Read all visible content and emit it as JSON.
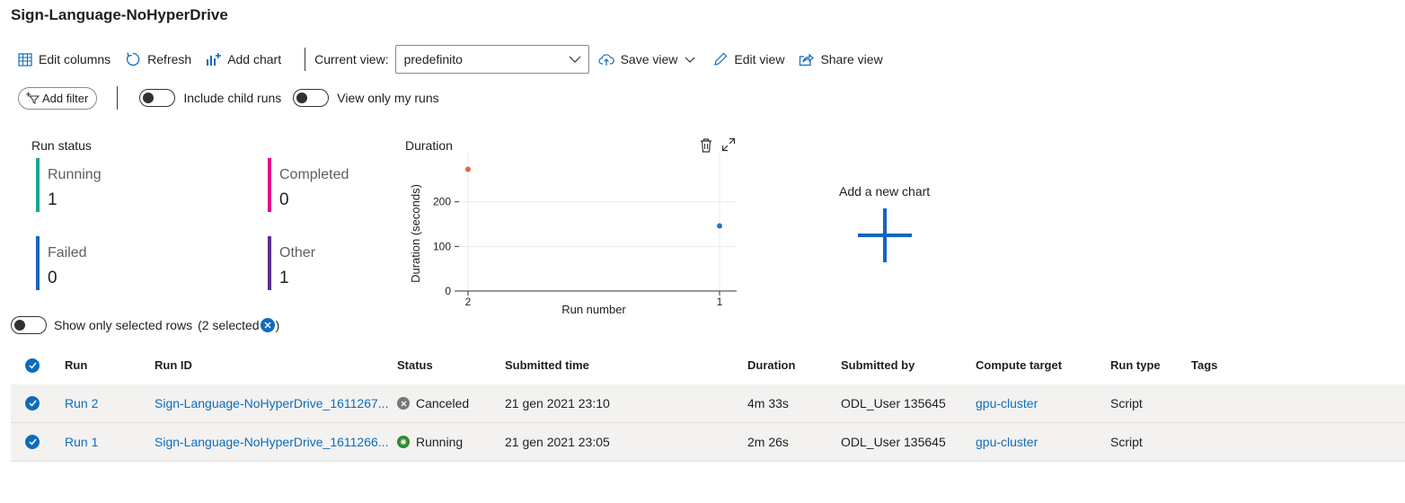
{
  "page_title": "Sign-Language-NoHyperDrive",
  "toolbar": {
    "edit_columns": "Edit columns",
    "refresh": "Refresh",
    "add_chart": "Add chart",
    "current_view_label": "Current view:",
    "current_view_value": "predefinito",
    "save_view": "Save view",
    "edit_view": "Edit view",
    "share_view": "Share view"
  },
  "filters": {
    "add_filter": "Add filter",
    "include_child_runs": "Include child runs",
    "view_only_my_runs": "View only my runs"
  },
  "run_status": {
    "title": "Run status",
    "items": [
      {
        "name": "Running",
        "value": "1",
        "color": "#1aa68a"
      },
      {
        "name": "Completed",
        "value": "0",
        "color": "#e3008c"
      },
      {
        "name": "Failed",
        "value": "0",
        "color": "#1565c0"
      },
      {
        "name": "Other",
        "value": "1",
        "color": "#5c2e91"
      }
    ]
  },
  "chart_data": {
    "type": "scatter",
    "title": "Duration",
    "xlabel": "Run number",
    "ylabel": "Duration (seconds)",
    "categories": [
      "2",
      "1"
    ],
    "values": [
      273,
      146
    ],
    "point_colors": [
      "#e8624a",
      "#1f77d0"
    ],
    "yticks": [
      0,
      100,
      200
    ],
    "ylim": [
      0,
      290
    ]
  },
  "add_new_chart": "Add a new chart",
  "selection": {
    "label": "Show only selected rows",
    "open": "(",
    "count": "2 selected",
    "close": ")"
  },
  "table": {
    "headers": [
      "Run",
      "Run ID",
      "Status",
      "Submitted time",
      "Duration",
      "Submitted by",
      "Compute target",
      "Run type",
      "Tags"
    ],
    "rows": [
      {
        "run": "Run 2",
        "run_id": "Sign-Language-NoHyperDrive_1611267...",
        "status": "Canceled",
        "submitted": "21 gen 2021 23:10",
        "duration": "4m 33s",
        "by": "ODL_User 135645",
        "target": "gpu-cluster",
        "type": "Script",
        "tags": ""
      },
      {
        "run": "Run 1",
        "run_id": "Sign-Language-NoHyperDrive_1611266...",
        "status": "Running",
        "submitted": "21 gen 2021 23:05",
        "duration": "2m 26s",
        "by": "ODL_User 135645",
        "target": "gpu-cluster",
        "type": "Script",
        "tags": ""
      }
    ]
  },
  "colors": {
    "accent": "#0f6cbd",
    "canceled": "#797775",
    "running": "#2e8b2e"
  }
}
